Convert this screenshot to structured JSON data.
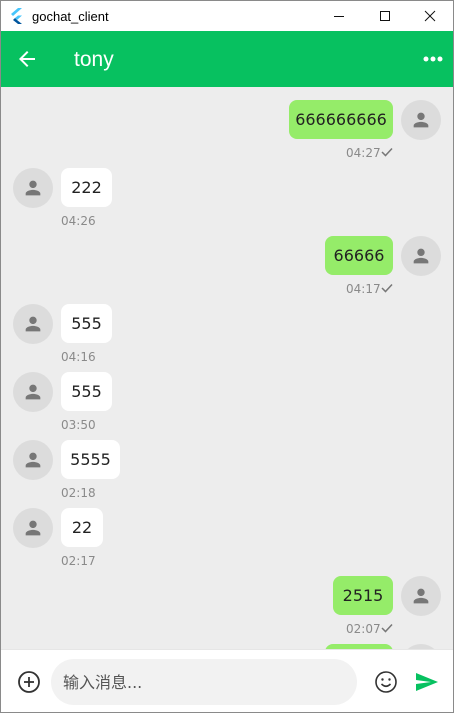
{
  "window": {
    "title": "gochat_client"
  },
  "appbar": {
    "title": "tony",
    "back_icon": "arrow-left-icon",
    "more_icon": "more-horiz-icon"
  },
  "messages": [
    {
      "side": "self",
      "text": "666666666",
      "time": "04:27",
      "status": "sent"
    },
    {
      "side": "other",
      "text": "222",
      "time": "04:26"
    },
    {
      "side": "self",
      "text": "66666",
      "time": "04:17",
      "status": "sent"
    },
    {
      "side": "other",
      "text": "555",
      "time": "04:16"
    },
    {
      "side": "other",
      "text": "555",
      "time": "03:50"
    },
    {
      "side": "other",
      "text": "5555",
      "time": "02:18"
    },
    {
      "side": "other",
      "text": "22",
      "time": "02:17"
    },
    {
      "side": "self",
      "text": "2515",
      "time": "02:07",
      "status": "sent"
    }
  ],
  "input": {
    "placeholder": "输入消息...",
    "value": ""
  },
  "colors": {
    "primary": "#07c160",
    "self_bubble": "#95ec69",
    "other_bubble": "#ffffff",
    "background": "#ededed"
  }
}
